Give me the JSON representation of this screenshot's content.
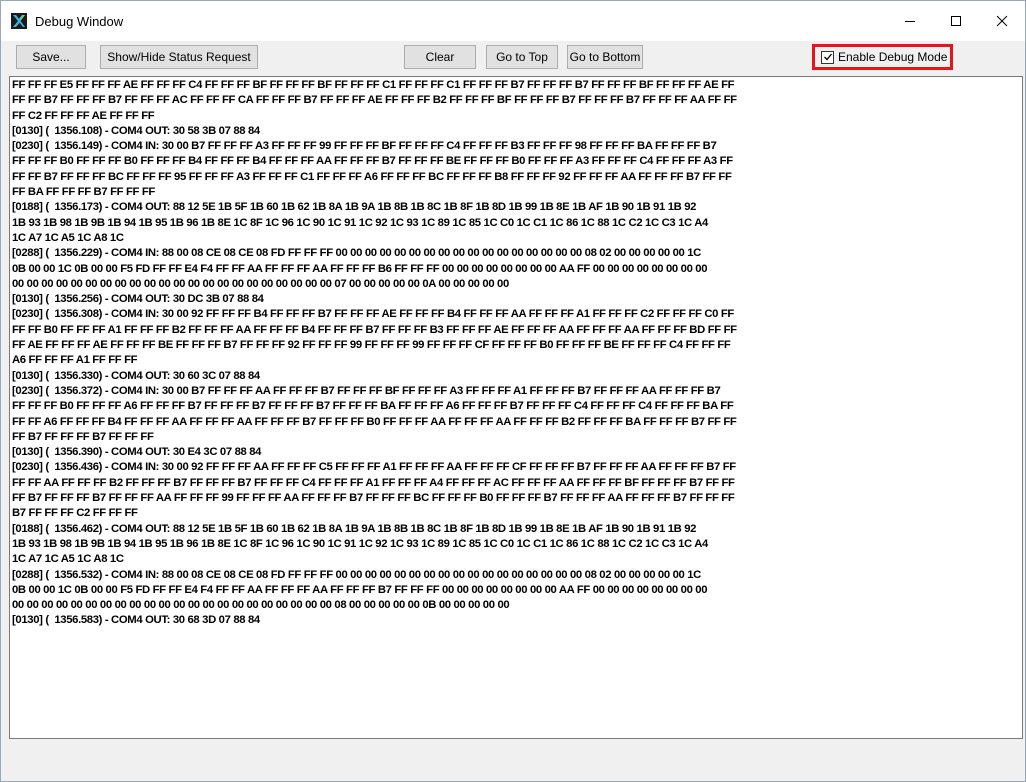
{
  "window": {
    "title": "Debug Window"
  },
  "toolbar": {
    "save_label": "Save...",
    "status_request_label": "Show/Hide Status Request",
    "clear_label": "Clear",
    "go_top_label": "Go to Top",
    "go_bottom_label": "Go to Bottom",
    "debug_mode_label": "Enable Debug Mode",
    "debug_mode_checked": true
  },
  "log": {
    "lines": [
      "FF FF FF E5 FF FF FF AE FF FF FF C4 FF FF FF BF FF FF FF BF FF FF FF C1 FF FF FF C1 FF FF FF B7 FF FF FF B7 FF FF FF BF FF FF FF AE FF",
      "FF FF B7 FF FF FF B7 FF FF FF AC FF FF FF CA FF FF FF B7 FF FF FF AE FF FF FF B2 FF FF FF BF FF FF FF B7 FF FF FF B7 FF FF FF AA FF FF",
      "FF C2 FF FF FF AE FF FF FF",
      "[0130] (  1356.108) - COM4 OUT: 30 58 3B 07 88 84",
      "[0230] (  1356.149) - COM4 IN: 30 00 B7 FF FF FF A3 FF FF FF 99 FF FF FF BF FF FF FF C4 FF FF FF B3 FF FF FF 98 FF FF FF BA FF FF FF B7",
      "FF FF FF B0 FF FF FF B0 FF FF FF B4 FF FF FF B4 FF FF FF AA FF FF FF B7 FF FF FF BE FF FF FF B0 FF FF FF A3 FF FF FF C4 FF FF FF A3 FF",
      "FF FF B7 FF FF FF BC FF FF FF 95 FF FF FF A3 FF FF FF C1 FF FF FF A6 FF FF FF BC FF FF FF B8 FF FF FF 92 FF FF FF AA FF FF FF B7 FF FF",
      "FF BA FF FF FF B7 FF FF FF",
      "[0188] (  1356.173) - COM4 OUT: 88 12 5E 1B 5F 1B 60 1B 62 1B 8A 1B 9A 1B 8B 1B 8C 1B 8F 1B 8D 1B 99 1B 8E 1B AF 1B 90 1B 91 1B 92",
      "1B 93 1B 98 1B 9B 1B 94 1B 95 1B 96 1B 8E 1C 8F 1C 96 1C 90 1C 91 1C 92 1C 93 1C 89 1C 85 1C C0 1C C1 1C 86 1C 88 1C C2 1C C3 1C A4",
      "1C A7 1C A5 1C A8 1C",
      "[0288] (  1356.229) - COM4 IN: 88 00 08 CE 08 CE 08 FD FF FF FF 00 00 00 00 00 00 00 00 00 00 00 00 00 00 00 00 00 08 02 00 00 00 00 00 1C",
      "0B 00 00 1C 0B 00 00 F5 FD FF FF E4 F4 FF FF AA FF FF FF AA FF FF FF B6 FF FF FF 00 00 00 00 00 00 00 00 AA FF 00 00 00 00 00 00 00 00",
      "00 00 00 00 00 00 00 00 00 00 00 00 00 00 00 00 00 00 00 00 00 00 07 00 00 00 00 00 0A 00 00 00 00 00",
      "[0130] (  1356.256) - COM4 OUT: 30 DC 3B 07 88 84",
      "[0230] (  1356.308) - COM4 IN: 30 00 92 FF FF FF B4 FF FF FF B7 FF FF FF AE FF FF FF B4 FF FF FF AA FF FF FF A1 FF FF FF C2 FF FF FF C0 FF",
      "FF FF B0 FF FF FF A1 FF FF FF B2 FF FF FF AA FF FF FF B4 FF FF FF B7 FF FF FF B3 FF FF FF AE FF FF FF AA FF FF FF AA FF FF FF BD FF FF",
      "FF AE FF FF FF AE FF FF FF BE FF FF FF B7 FF FF FF 92 FF FF FF 99 FF FF FF 99 FF FF FF CF FF FF FF B0 FF FF FF BE FF FF FF C4 FF FF FF",
      "A6 FF FF FF A1 FF FF FF",
      "[0130] (  1356.330) - COM4 OUT: 30 60 3C 07 88 84",
      "[0230] (  1356.372) - COM4 IN: 30 00 B7 FF FF FF AA FF FF FF B7 FF FF FF BF FF FF FF A3 FF FF FF A1 FF FF FF B7 FF FF FF AA FF FF FF B7",
      "FF FF FF B0 FF FF FF A6 FF FF FF B7 FF FF FF B7 FF FF FF B7 FF FF FF BA FF FF FF A6 FF FF FF B7 FF FF FF C4 FF FF FF C4 FF FF FF BA FF",
      "FF FF A6 FF FF FF B4 FF FF FF AA FF FF FF AA FF FF FF B7 FF FF FF B0 FF FF FF AA FF FF FF AA FF FF FF B2 FF FF FF BA FF FF FF B7 FF FF",
      "FF B7 FF FF FF B7 FF FF FF",
      "[0130] (  1356.390) - COM4 OUT: 30 E4 3C 07 88 84",
      "[0230] (  1356.436) - COM4 IN: 30 00 92 FF FF FF AA FF FF FF C5 FF FF FF A1 FF FF FF AA FF FF FF CF FF FF FF B7 FF FF FF AA FF FF FF B7 FF",
      "FF FF AA FF FF FF B2 FF FF FF B7 FF FF FF B7 FF FF FF C4 FF FF FF A1 FF FF FF A4 FF FF FF AC FF FF FF AA FF FF FF BF FF FF FF B7 FF FF",
      "FF B7 FF FF FF B7 FF FF FF AA FF FF FF 99 FF FF FF AA FF FF FF B7 FF FF FF BC FF FF FF B0 FF FF FF B7 FF FF FF AA FF FF FF B7 FF FF FF",
      "B7 FF FF FF C2 FF FF FF",
      "[0188] (  1356.462) - COM4 OUT: 88 12 5E 1B 5F 1B 60 1B 62 1B 8A 1B 9A 1B 8B 1B 8C 1B 8F 1B 8D 1B 99 1B 8E 1B AF 1B 90 1B 91 1B 92",
      "1B 93 1B 98 1B 9B 1B 94 1B 95 1B 96 1B 8E 1C 8F 1C 96 1C 90 1C 91 1C 92 1C 93 1C 89 1C 85 1C C0 1C C1 1C 86 1C 88 1C C2 1C C3 1C A4",
      "1C A7 1C A5 1C A8 1C",
      "[0288] (  1356.532) - COM4 IN: 88 00 08 CE 08 CE 08 FD FF FF FF 00 00 00 00 00 00 00 00 00 00 00 00 00 00 00 00 00 08 02 00 00 00 00 00 1C",
      "0B 00 00 1C 0B 00 00 F5 FD FF FF E4 F4 FF FF AA FF FF FF AA FF FF FF B7 FF FF FF 00 00 00 00 00 00 00 00 AA FF 00 00 00 00 00 00 00 00",
      "00 00 00 00 00 00 00 00 00 00 00 00 00 00 00 00 00 00 00 00 00 00 08 00 00 00 00 00 0B 00 00 00 00 00",
      "[0130] (  1356.583) - COM4 OUT: 30 68 3D 07 88 84"
    ]
  }
}
